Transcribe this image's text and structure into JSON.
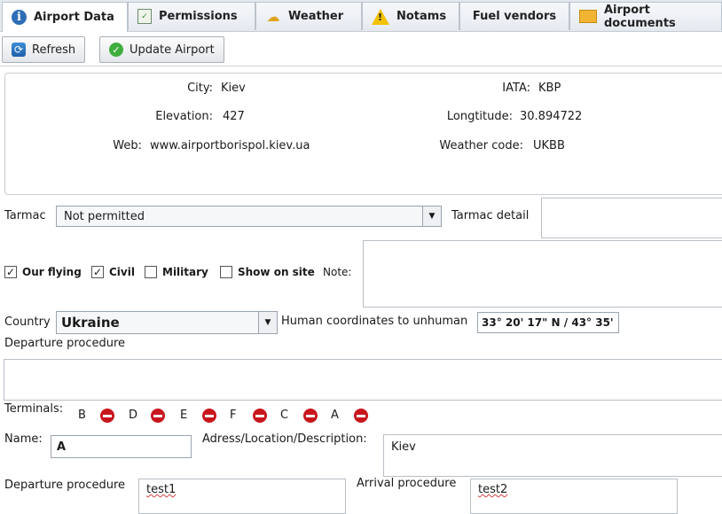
{
  "tabs": [
    {
      "label": "Airport Data",
      "icon": "info-icon"
    },
    {
      "label": "Permissions",
      "icon": "permissions-icon"
    },
    {
      "label": "Weather",
      "icon": "weather-icon"
    },
    {
      "label": "Notams",
      "icon": "warning-icon"
    },
    {
      "label": "Fuel vendors",
      "icon": ""
    },
    {
      "label": "Airport documents",
      "icon": "documents-icon"
    }
  ],
  "toolbar": {
    "refresh_label": "Refresh",
    "update_label": "Update Airport"
  },
  "info": {
    "city_label": "City:",
    "city": "Kiev",
    "iata_label": "IATA:",
    "iata": "KBP",
    "elevation_label": "Elevation:",
    "elevation": "427",
    "longitude_label": "Longtitude:",
    "longitude": "30.894722",
    "web_label": "Web:",
    "web": "www.airportborispol.kiev.ua",
    "weather_code_label": "Weather code:",
    "weather_code": "UKBB"
  },
  "form": {
    "tarmac_label": "Tarmac",
    "tarmac_value": "Not permitted",
    "tarmac_detail_label": "Tarmac detail",
    "checkboxes": [
      {
        "label": "Our flying",
        "checked": true
      },
      {
        "label": "Civil",
        "checked": true
      },
      {
        "label": "Military",
        "checked": false
      },
      {
        "label": "Show on site",
        "checked": false
      }
    ],
    "note_label": "Note:",
    "country_label": "Country",
    "country_value": "Ukraine",
    "coords_label": "Human coordinates to unhuman",
    "coords_value": "33° 20' 17\" N / 43° 35'",
    "departure_procedure_label": "Departure procedure",
    "terminals_label": "Terminals:",
    "terminals": [
      "B",
      "D",
      "E",
      "F",
      "C",
      "A"
    ]
  },
  "terminal": {
    "name_label": "Name:",
    "name_value": "A",
    "address_label": "Adress/Location/Description:",
    "address_value": "Kiev",
    "departure_label": "Departure procedure",
    "departure_value": "test1",
    "arrival_label": "Arrival procedure",
    "arrival_value": "test2"
  }
}
